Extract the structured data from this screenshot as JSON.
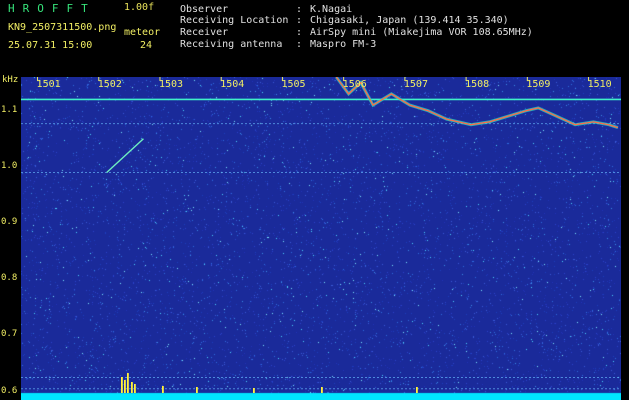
{
  "header": {
    "brand": "HROFFT",
    "version": "1.00f",
    "filename": "KN9_2507311500.png",
    "timestamp": "25.07.31 15:00",
    "mode_label": "meteor",
    "mode_value": "24"
  },
  "station_info": [
    {
      "label": "Observer",
      "value": "K.Nagai"
    },
    {
      "label": "Receiving Location",
      "value": "Chigasaki, Japan (139.414 35.340)"
    },
    {
      "label": "Receiver",
      "value": "AirSpy mini (Miakejima VOR 108.65MHz)"
    },
    {
      "label": "Receiving antenna",
      "value": "Maspro FM-3"
    }
  ],
  "separator": ":",
  "chart_data": {
    "type": "heatmap",
    "ylabel": "kHz",
    "x_ticks": [
      "1501",
      "1502",
      "1503",
      "1504",
      "1505",
      "1506",
      "1507",
      "1508",
      "1509",
      "1510"
    ],
    "y_ticks": [
      "1.1",
      "1.0",
      "0.9",
      "0.8",
      "0.7",
      "0.6"
    ],
    "ylim": [
      0.585,
      1.16
    ],
    "horizontal_lines_khz": [
      1.12,
      1.077,
      0.99,
      0.625,
      0.605
    ],
    "meteor_trace": [
      {
        "x": 1501.95,
        "y": 0.99
      },
      {
        "x": 1502.55,
        "y": 1.05
      }
    ],
    "aircraft_trace": [
      {
        "x": 1505.7,
        "y": 1.16
      },
      {
        "x": 1505.9,
        "y": 1.13
      },
      {
        "x": 1506.1,
        "y": 1.15
      },
      {
        "x": 1506.3,
        "y": 1.11
      },
      {
        "x": 1506.6,
        "y": 1.13
      },
      {
        "x": 1506.9,
        "y": 1.11
      },
      {
        "x": 1507.2,
        "y": 1.1
      },
      {
        "x": 1507.5,
        "y": 1.085
      },
      {
        "x": 1507.9,
        "y": 1.075
      },
      {
        "x": 1508.2,
        "y": 1.08
      },
      {
        "x": 1508.5,
        "y": 1.09
      },
      {
        "x": 1508.8,
        "y": 1.1
      },
      {
        "x": 1509.0,
        "y": 1.105
      },
      {
        "x": 1509.3,
        "y": 1.09
      },
      {
        "x": 1509.6,
        "y": 1.075
      },
      {
        "x": 1509.9,
        "y": 1.08
      },
      {
        "x": 1510.15,
        "y": 1.075
      },
      {
        "x": 1510.3,
        "y": 1.07
      }
    ],
    "colors": {
      "background": "#1a2a9a",
      "noise_hi": "#4fd6ff",
      "line": "#2ee6d6",
      "trace": "#ff6a4a",
      "baseline": "#00e5ff",
      "spike": "#fff23a"
    }
  }
}
